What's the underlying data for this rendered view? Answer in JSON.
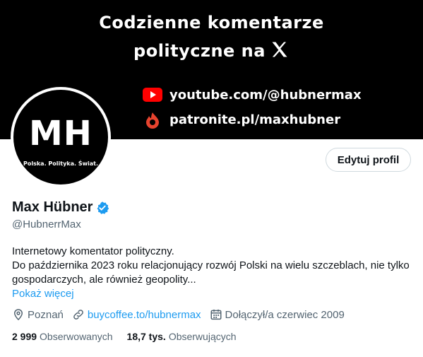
{
  "banner": {
    "line1": "Codzienne komentarze",
    "line2": "polityczne na",
    "youtube": "youtube.com/@hubnermax",
    "patronite": "patronite.pl/maxhubner",
    "background": "#000000"
  },
  "avatar": {
    "initials": "MH",
    "tagline": "Polska. Polityka. Świat."
  },
  "profile": {
    "edit_label": "Edytuj profil",
    "name": "Max Hübner",
    "handle": "@HubnerrMax",
    "bio_line1": "Internetowy komentator polityczny.",
    "bio_line2": "Do października 2023 roku relacjonujący rozwój Polski na wielu szczeblach, nie tylko gospodarczych, ale również geopolity...",
    "show_more": "Pokaż więcej",
    "location": "Poznań",
    "link": "buycoffee.to/hubnermax",
    "joined": "Dołączył/a czerwiec 2009",
    "following_count": "2 999",
    "following_label": "Obserwowanych",
    "followers_count": "18,7 tys.",
    "followers_label": "Obserwujących"
  },
  "colors": {
    "accent": "#1d9bf0",
    "secondary_text": "#536471",
    "youtube_red": "#ff0000",
    "patronite_red": "#e6432e"
  },
  "icons": [
    "x-logo-icon",
    "youtube-icon",
    "patronite-icon",
    "verified-badge-icon",
    "location-pin-icon",
    "link-icon",
    "calendar-icon"
  ]
}
